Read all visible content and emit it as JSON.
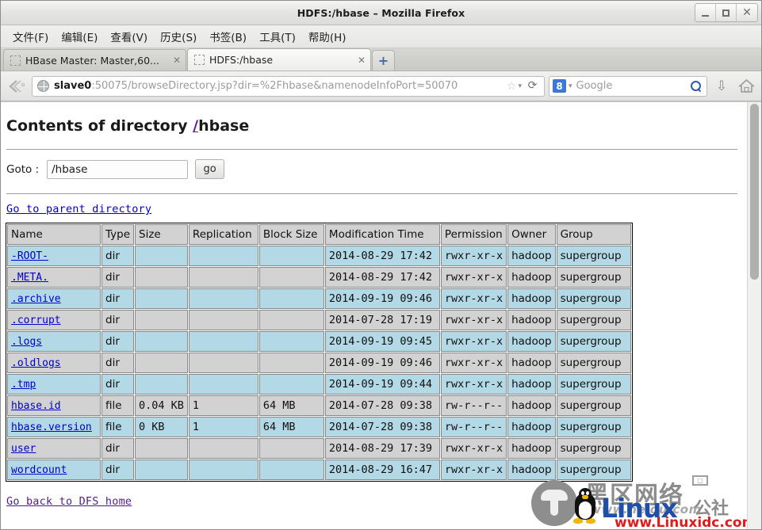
{
  "window": {
    "title": "HDFS:/hbase – Mozilla Firefox",
    "minimize_label": "_",
    "maximize_label": "□",
    "close_label": "✕"
  },
  "menubar": {
    "items": [
      {
        "label": "文件(F)"
      },
      {
        "label": "编辑(E)"
      },
      {
        "label": "查看(V)"
      },
      {
        "label": "历史(S)"
      },
      {
        "label": "书签(B)"
      },
      {
        "label": "工具(T)"
      },
      {
        "label": "帮助(H)"
      }
    ]
  },
  "tabs": [
    {
      "label": "HBase Master: Master,60...",
      "close_label": "✕",
      "active": false
    },
    {
      "label": "HDFS:/hbase",
      "close_label": "✕",
      "active": true
    }
  ],
  "newtab": {
    "label": "+"
  },
  "navbar": {
    "back_icon": "back-arrow-icon",
    "url_host": "slave0",
    "url_rest": ":50075/browseDirectory.jsp?dir=%2Fhbase&namenodeInfoPort=50070",
    "star_label": "☆",
    "chevron_label": "▾",
    "reload_label": "⟳",
    "search_engine": "8",
    "search_chevron": "▾",
    "search_placeholder": "Google",
    "download_label": "⇩",
    "home_label": "⌂"
  },
  "page": {
    "heading_prefix": "Contents of directory ",
    "heading_root_link": "/",
    "heading_suffix": "hbase",
    "goto_label": "Goto :",
    "goto_value": "/hbase",
    "goto_placeholder": "/hbase",
    "go_button": "go",
    "parent_link": "Go to parent directory",
    "dfs_home_link": "Go back to DFS home"
  },
  "table": {
    "headers": [
      "Name",
      "Type",
      "Size",
      "Replication",
      "Block Size",
      "Modification Time",
      "Permission",
      "Owner",
      "Group"
    ],
    "rows": [
      {
        "name": "-ROOT-",
        "type": "dir",
        "size": "",
        "replication": "",
        "block_size": "",
        "modified": "2014-08-29 17:42",
        "permission": "rwxr-xr-x",
        "owner": "hadoop",
        "group": "supergroup"
      },
      {
        "name": ".META.",
        "type": "dir",
        "size": "",
        "replication": "",
        "block_size": "",
        "modified": "2014-08-29 17:42",
        "permission": "rwxr-xr-x",
        "owner": "hadoop",
        "group": "supergroup"
      },
      {
        "name": ".archive",
        "type": "dir",
        "size": "",
        "replication": "",
        "block_size": "",
        "modified": "2014-09-19 09:46",
        "permission": "rwxr-xr-x",
        "owner": "hadoop",
        "group": "supergroup"
      },
      {
        "name": ".corrupt",
        "type": "dir",
        "size": "",
        "replication": "",
        "block_size": "",
        "modified": "2014-07-28 17:19",
        "permission": "rwxr-xr-x",
        "owner": "hadoop",
        "group": "supergroup"
      },
      {
        "name": ".logs",
        "type": "dir",
        "size": "",
        "replication": "",
        "block_size": "",
        "modified": "2014-09-19 09:45",
        "permission": "rwxr-xr-x",
        "owner": "hadoop",
        "group": "supergroup"
      },
      {
        "name": ".oldlogs",
        "type": "dir",
        "size": "",
        "replication": "",
        "block_size": "",
        "modified": "2014-09-19 09:46",
        "permission": "rwxr-xr-x",
        "owner": "hadoop",
        "group": "supergroup"
      },
      {
        "name": ".tmp",
        "type": "dir",
        "size": "",
        "replication": "",
        "block_size": "",
        "modified": "2014-09-19 09:44",
        "permission": "rwxr-xr-x",
        "owner": "hadoop",
        "group": "supergroup"
      },
      {
        "name": "hbase.id",
        "type": "file",
        "size": "0.04 KB",
        "replication": "1",
        "block_size": "64 MB",
        "modified": "2014-07-28 09:38",
        "permission": "rw-r--r--",
        "owner": "hadoop",
        "group": "supergroup"
      },
      {
        "name": "hbase.version",
        "type": "file",
        "size": "0 KB",
        "replication": "1",
        "block_size": "64 MB",
        "modified": "2014-07-28 09:38",
        "permission": "rw-r--r--",
        "owner": "hadoop",
        "group": "supergroup"
      },
      {
        "name": "user",
        "type": "dir",
        "size": "",
        "replication": "",
        "block_size": "",
        "modified": "2014-08-29 17:39",
        "permission": "rwxr-xr-x",
        "owner": "hadoop",
        "group": "supergroup"
      },
      {
        "name": "wordcount",
        "type": "dir",
        "size": "",
        "replication": "",
        "block_size": "",
        "modified": "2014-08-29 16:47",
        "permission": "rwxr-xr-x",
        "owner": "hadoop",
        "group": "supergroup"
      }
    ]
  },
  "watermark": {
    "chinese_brand": "黑区网络",
    "chinese_site": "www.heiqu.com",
    "linux_word": "Linux",
    "gongshe": "公社",
    "linuxidc_site": "www.Linuxidc.com"
  }
}
